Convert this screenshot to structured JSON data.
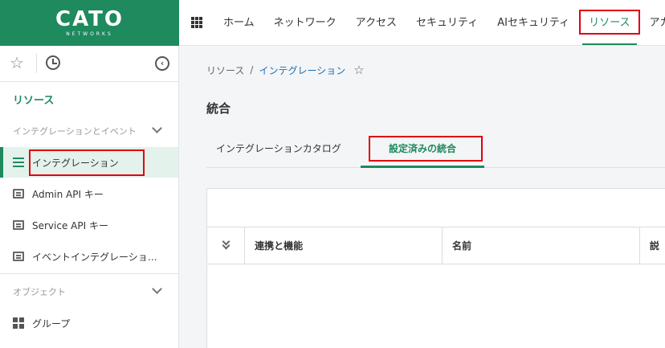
{
  "brand": {
    "name": "CATO",
    "sub": "NETWORKS"
  },
  "topnav": {
    "items": [
      "ホーム",
      "ネットワーク",
      "アクセス",
      "セキュリティ",
      "AIセキュリティ",
      "リソース",
      "アカ"
    ],
    "active_index": 5
  },
  "sidebar": {
    "title": "リソース",
    "section1": "インテグレーションとイベント",
    "items": [
      "インテグレーション",
      "Admin API キー",
      "Service API キー",
      "イベントインテグレーショ…"
    ],
    "section2": "オブジェクト",
    "objects": [
      "グループ"
    ]
  },
  "breadcrumb": {
    "root": "リソース",
    "separator": "/",
    "current": "インテグレーション"
  },
  "page_title": "統合",
  "tabs": [
    "インテグレーションカタログ",
    "設定済みの統合"
  ],
  "table": {
    "columns": [
      "連携と機能",
      "名前",
      "説"
    ]
  },
  "colors": {
    "brand": "#1e8a5e",
    "highlight": "#e0000f",
    "link": "#1a6fb5"
  }
}
